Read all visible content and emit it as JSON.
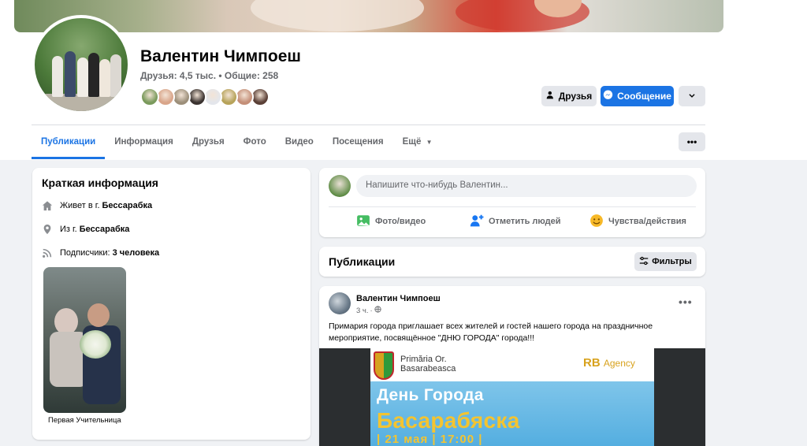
{
  "profile": {
    "name": "Валентин Чимпоеш",
    "friends_summary": "Друзья: 4,5 тыс. • Общие: 258",
    "friend_avatar_colors": [
      "#7a9a5c",
      "#d9a58a",
      "#9c8f7a",
      "#3b3330",
      "#e4e6eb",
      "#b7a35a",
      "#c48f78",
      "#5a3f36"
    ]
  },
  "actions": {
    "friends_label": "Друзья",
    "message_label": "Сообщение"
  },
  "tabs": [
    {
      "label": "Публикации"
    },
    {
      "label": "Информация"
    },
    {
      "label": "Друзья"
    },
    {
      "label": "Фото"
    },
    {
      "label": "Видео"
    },
    {
      "label": "Посещения"
    },
    {
      "label": "Ещё"
    }
  ],
  "tabs_more_label": "•••",
  "intro": {
    "title": "Краткая информация",
    "lives_prefix": "Живет в г.",
    "lives_value": "Бессарабка",
    "from_prefix": "Из г.",
    "from_value": "Бессарабка",
    "followers_prefix": "Подписчики:",
    "followers_value": "3 человека",
    "featured_caption": "Первая Учительница"
  },
  "composer": {
    "placeholder": "Напишите что-нибудь Валентин...",
    "photo_video": "Фото/видео",
    "tag_people": "Отметить людей",
    "feeling": "Чувства/действия"
  },
  "publications": {
    "title": "Публикации",
    "filters_label": "Фильтры"
  },
  "post": {
    "author": "Валентин Чимпоеш",
    "time": "3 ч.",
    "more_label": "•••",
    "text": "Примария города приглашает всех жителей и гостей нашего города на праздничное мероприятие, посвящённое  \"ДНЮ ГОРОДА\" города!!!",
    "poster": {
      "org_line1": "Primăria Or.",
      "org_line2": "Basarabeasca",
      "agency_rb": "RB",
      "agency_word": "Agency",
      "title1": "День Города",
      "title2": "Басарабяска",
      "date": "| 21 мая | 17:00 |"
    }
  },
  "colors": {
    "brand_blue": "#1b74e4",
    "page_bg": "#f0f2f5",
    "secondary_text": "#65676b"
  }
}
